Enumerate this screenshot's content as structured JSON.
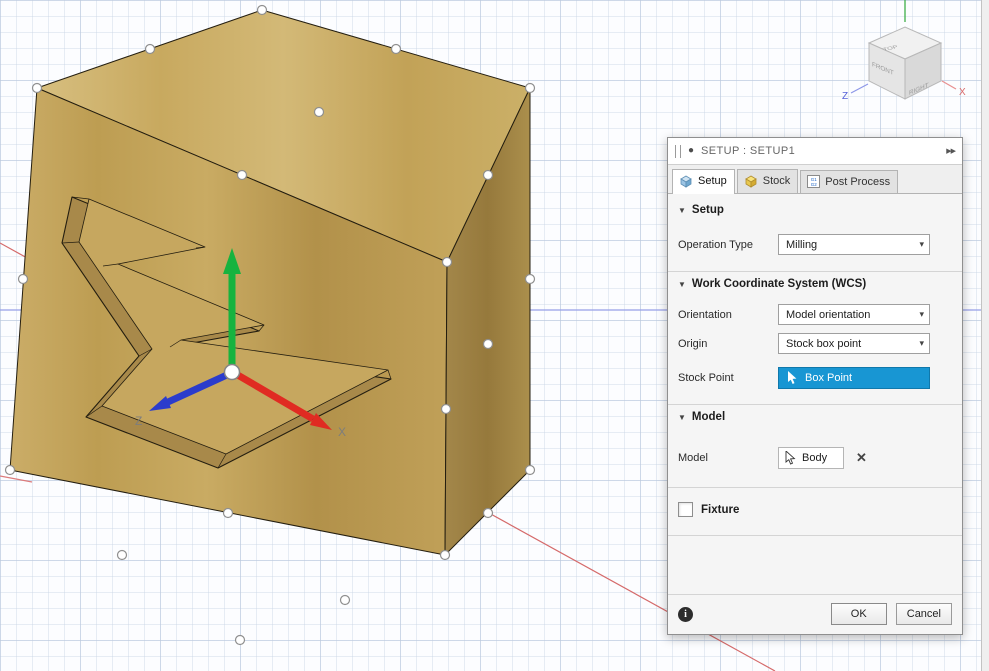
{
  "icons": {
    "section_caret": "▼",
    "dropdown_caret": "▾",
    "close": "✕",
    "collapse": "▶▶",
    "info": "i",
    "header_dot": "●"
  },
  "viewport": {
    "triad_x_label": "X",
    "triad_z_label": "Z",
    "viewcube": {
      "top": "TOP",
      "front": "FRONT",
      "right": "RIGHT",
      "x_label": "X",
      "z_label": "Z"
    }
  },
  "dialog": {
    "title": "SETUP : SETUP1",
    "tabs": [
      {
        "label": "Setup"
      },
      {
        "label": "Stock"
      },
      {
        "label": "Post Process"
      }
    ],
    "post_icon": {
      "line1": "G1",
      "line2": "G2"
    },
    "setup_section": {
      "title": "Setup",
      "operation_type": {
        "label": "Operation Type",
        "value": "Milling"
      }
    },
    "wcs_section": {
      "title": "Work Coordinate System (WCS)",
      "orientation": {
        "label": "Orientation",
        "value": "Model orientation"
      },
      "origin": {
        "label": "Origin",
        "value": "Stock box point"
      },
      "stock_point": {
        "label": "Stock Point",
        "value": "Box Point"
      }
    },
    "model_section": {
      "title": "Model",
      "model": {
        "label": "Model",
        "value": "Body"
      }
    },
    "fixture": {
      "label": "Fixture",
      "checked": false
    },
    "footer": {
      "ok": "OK",
      "cancel": "Cancel"
    }
  },
  "colors": {
    "accent_blue": "#1896d3",
    "model_tan": "#c1a156",
    "axis_red": "#e02b22",
    "axis_green": "#17b33f",
    "axis_blue": "#2b3ccc"
  }
}
